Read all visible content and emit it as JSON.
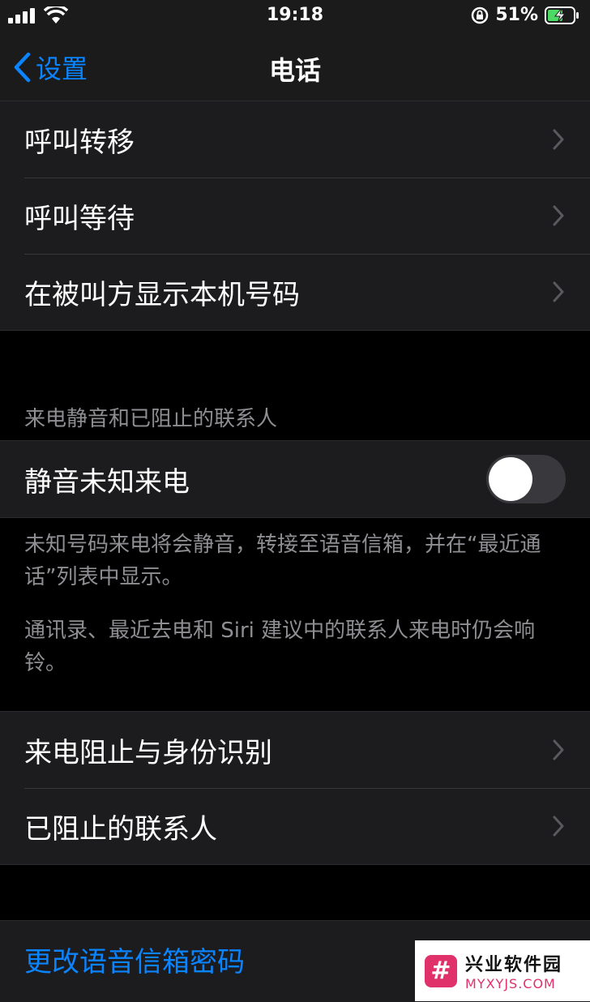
{
  "status": {
    "time": "19:18",
    "battery": "51%"
  },
  "nav": {
    "back_label": "设置",
    "title": "电话"
  },
  "group1": {
    "items": [
      {
        "label": "呼叫转移"
      },
      {
        "label": "呼叫等待"
      },
      {
        "label": "在被叫方显示本机号码"
      }
    ]
  },
  "silence": {
    "header": "来电静音和已阻止的联系人",
    "toggle_label": "静音未知来电",
    "toggle_on": false,
    "footer1": "未知号码来电将会静音，转接至语音信箱，并在“最近通话”列表中显示。",
    "footer2": "通讯录、最近去电和 Siri 建议中的联系人来电时仍会响铃。"
  },
  "group2": {
    "items": [
      {
        "label": "来电阻止与身份识别"
      },
      {
        "label": "已阻止的联系人"
      }
    ]
  },
  "voicemail": {
    "change_password": "更改语音信箱密码"
  },
  "watermark": {
    "name": "兴业软件园",
    "url": "MYXYJS.COM"
  },
  "colors": {
    "accent": "#0a84ff",
    "cell": "#1c1c1e",
    "background": "#000000",
    "watermark": "#e0316b"
  }
}
